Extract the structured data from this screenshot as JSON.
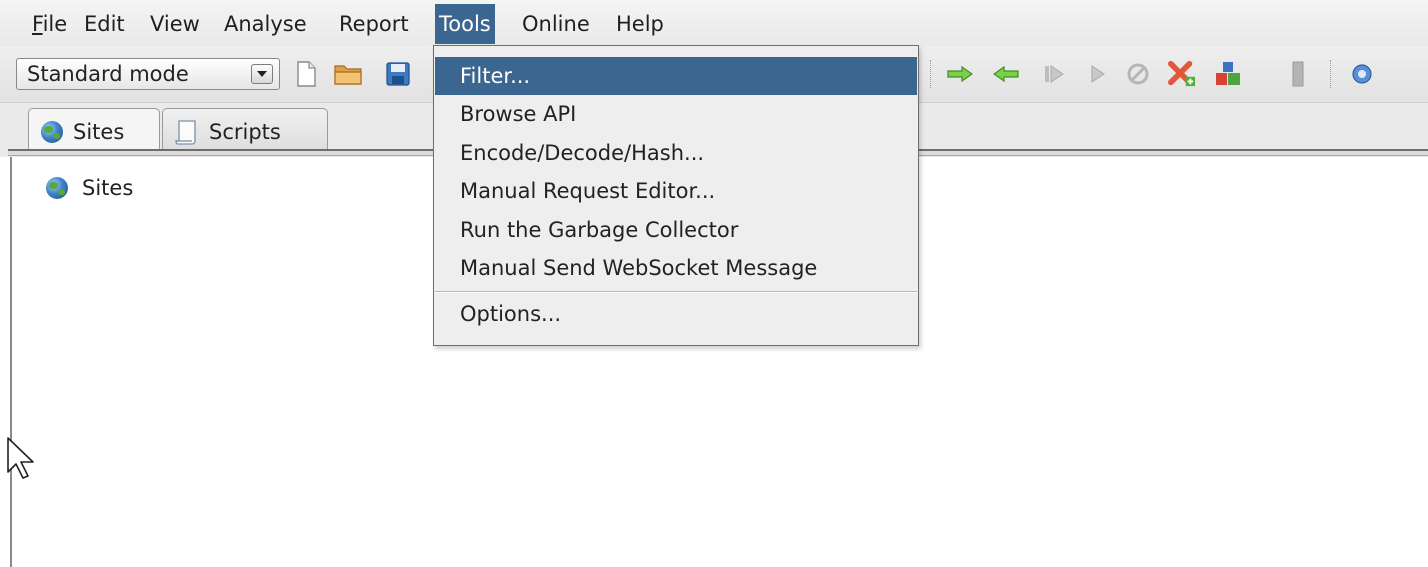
{
  "menubar": {
    "file": {
      "mnemonic": "F",
      "rest": "ile"
    },
    "edit": "Edit",
    "view": "View",
    "analyse": "Analyse",
    "report": "Report",
    "tools": "Tools",
    "online": "Online",
    "help": "Help"
  },
  "toolbar": {
    "mode_value": "Standard mode"
  },
  "tabs": [
    {
      "label": "Sites",
      "icon": "globe-icon",
      "selected": true
    },
    {
      "label": "Scripts",
      "icon": "script-icon",
      "selected": false
    }
  ],
  "tree": {
    "root_label": "Sites"
  },
  "tools_menu": {
    "items": [
      {
        "label": "Filter...",
        "highlighted": true
      },
      {
        "label": "Browse API"
      },
      {
        "label": "Encode/Decode/Hash..."
      },
      {
        "label": "Manual Request Editor..."
      },
      {
        "label": "Run the Garbage Collector"
      },
      {
        "label": "Manual Send WebSocket Message"
      }
    ],
    "options_label": "Options..."
  },
  "colors": {
    "highlight": "#3a6690",
    "menu_bg": "#eeeeee",
    "toolbar_bg": "#e6e6e6",
    "arrow_green": "#4caf2a",
    "stop_red": "#d9472b"
  }
}
